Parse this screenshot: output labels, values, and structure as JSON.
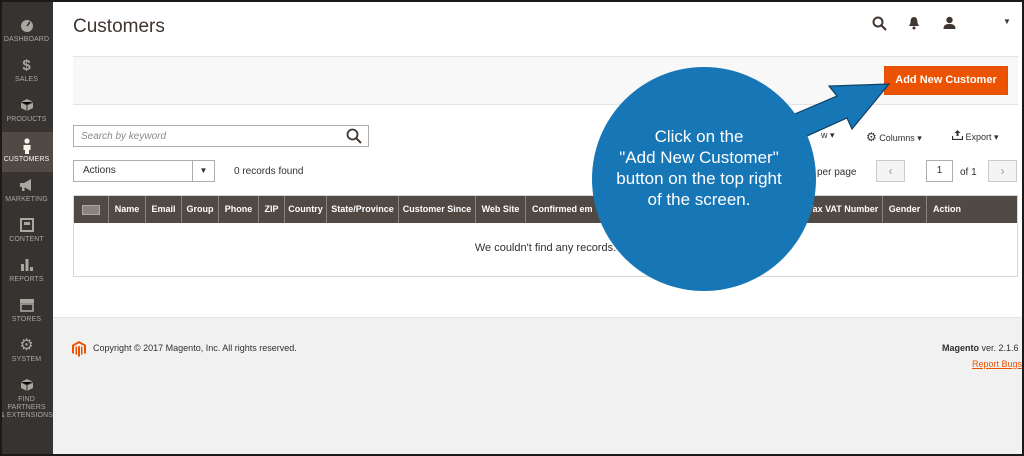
{
  "sidebar": {
    "items": [
      {
        "label": "DASHBOARD",
        "icon": "dashboard-icon",
        "glyph": "◔"
      },
      {
        "label": "SALES",
        "icon": "dollar-icon",
        "glyph": "$"
      },
      {
        "label": "PRODUCTS",
        "icon": "cube-icon",
        "glyph": "◆"
      },
      {
        "label": "CUSTOMERS",
        "icon": "person-icon",
        "glyph": "♟",
        "active": true
      },
      {
        "label": "MARKETING",
        "icon": "megaphone-icon",
        "glyph": "📢"
      },
      {
        "label": "CONTENT",
        "icon": "content-icon",
        "glyph": "▣"
      },
      {
        "label": "REPORTS",
        "icon": "bar-chart-icon",
        "glyph": "▮"
      },
      {
        "label": "STORES",
        "icon": "store-icon",
        "glyph": "⌂"
      },
      {
        "label": "SYSTEM",
        "icon": "gear-icon",
        "glyph": "⚙"
      },
      {
        "label": "FIND PARTNERS & EXTENSIONS",
        "label_line1": "FIND PARTNERS",
        "label_line2": "& EXTENSIONS",
        "icon": "extensions-icon",
        "glyph": "◈"
      }
    ]
  },
  "header": {
    "title": "Customers",
    "icons": [
      "search-icon",
      "bell-icon",
      "user-icon",
      "chevron-down-icon"
    ]
  },
  "action_bar": {
    "add_button_label": "Add New Customer",
    "accent_color": "#eb5202"
  },
  "toolbar": {
    "search_placeholder": "Search by keyword",
    "filters_label": "w",
    "columns_label": "Columns",
    "export_label": "Export",
    "actions_label": "Actions",
    "records_found": "0 records found",
    "per_page_label": "per page",
    "current_page": "1",
    "page_of": "of 1"
  },
  "grid": {
    "columns": [
      "Name",
      "Email",
      "Group",
      "Phone",
      "ZIP",
      "Country",
      "State/Province",
      "Customer Since",
      "Web Site",
      "Confirmed em",
      "e of Birth",
      "Tax VAT Number",
      "Gender",
      "Action"
    ],
    "empty_message": "We couldn't find any records."
  },
  "footer": {
    "copyright": "Copyright © 2017 Magento, Inc. All rights reserved.",
    "brand": "Magento",
    "version": " ver. 2.1.6",
    "report_bugs": "Report Bugs"
  },
  "callout": {
    "lines": [
      "Click on the",
      "\"Add New Customer\"",
      "button on the top right",
      "of the screen."
    ],
    "color": "#1776b6"
  }
}
